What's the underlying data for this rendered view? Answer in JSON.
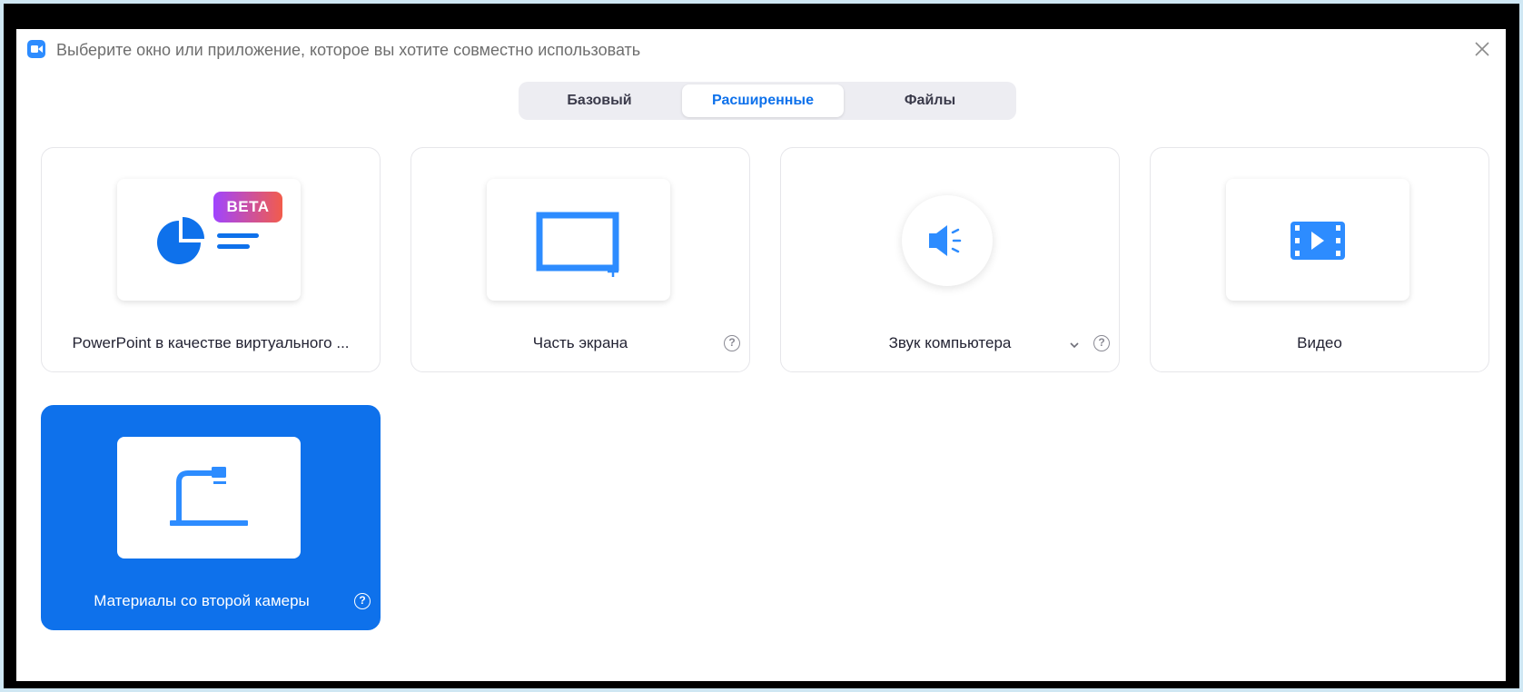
{
  "window": {
    "title": "Выберите окно или приложение, которое вы хотите совместно использовать",
    "app_icon": "zoom-camera-icon",
    "close_icon": "close-icon"
  },
  "tabs": [
    {
      "label": "Базовый",
      "active": false
    },
    {
      "label": "Расширенные",
      "active": true
    },
    {
      "label": "Файлы",
      "active": false
    }
  ],
  "options": [
    {
      "label": "PowerPoint в качестве виртуального ...",
      "icon": "powerpoint-chart-icon",
      "badge": "BETA",
      "selected": false
    },
    {
      "label": "Часть экрана",
      "icon": "screen-portion-icon",
      "help": "?",
      "selected": false
    },
    {
      "label": "Звук компьютера",
      "icon": "speaker-icon",
      "has_dropdown": true,
      "help": "?",
      "selected": false
    },
    {
      "label": "Видео",
      "icon": "video-film-icon",
      "selected": false
    },
    {
      "label": "Материалы со второй камеры",
      "icon": "document-camera-icon",
      "help": "?",
      "selected": true
    }
  ],
  "colors": {
    "accent": "#0e71eb",
    "icon_blue": "#2d8cff",
    "beta_gradient_start": "#a044ff",
    "beta_gradient_end": "#f25c4b"
  }
}
